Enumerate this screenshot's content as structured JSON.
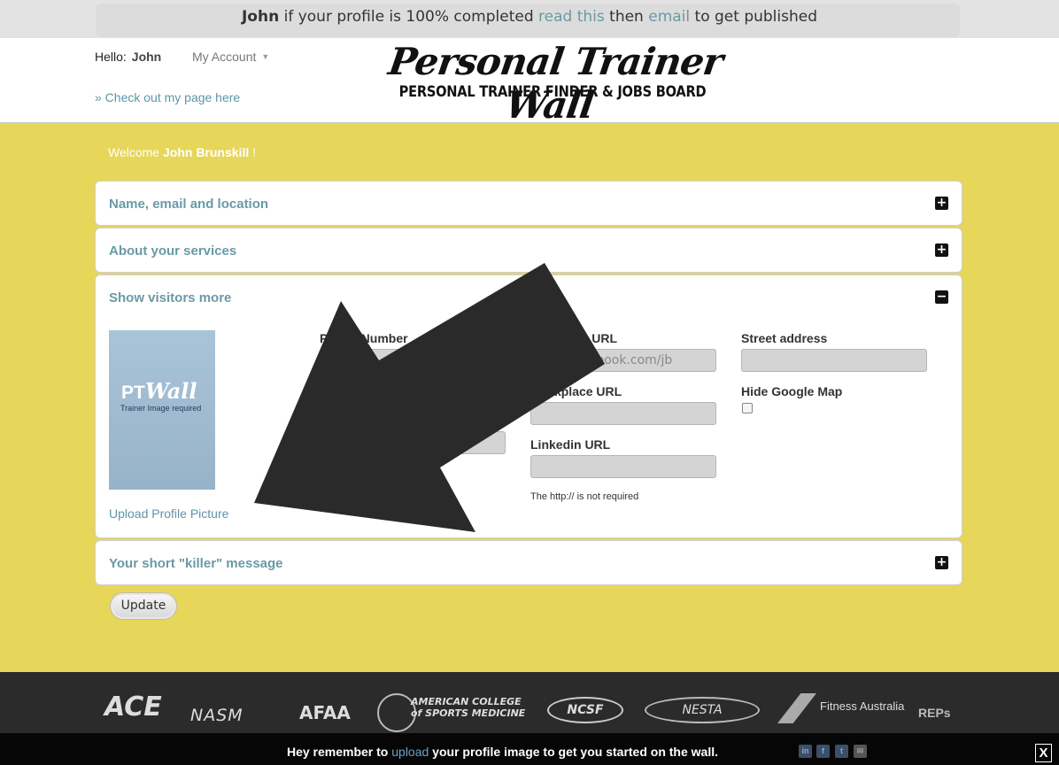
{
  "topbar": {
    "name": "John",
    "text1": " if your profile is 100% completed ",
    "link1": "read this",
    "text2": " then ",
    "link2": "email",
    "text3": " to get published"
  },
  "header": {
    "hello_label": "Hello:",
    "hello_name": "John",
    "my_account": "My Account",
    "check_page": "» Check out my page here",
    "logo_title": "Personal Trainer Wall",
    "logo_subtitle": "PERSONAL TRAINER FINDER & JOBS BOARD"
  },
  "main": {
    "welcome_prefix": "Welcome ",
    "welcome_name": "John Brunskill",
    "welcome_suffix": " !",
    "panels": [
      {
        "title": "Name, email and location",
        "toggle": "+"
      },
      {
        "title": "About your services",
        "toggle": "+"
      },
      {
        "title": "Show visitors more",
        "toggle": "−"
      },
      {
        "title": "Your short \"killer\" message",
        "toggle": "+"
      }
    ],
    "thumbnail": {
      "brand_pt": "PT",
      "brand_wall": "Wall",
      "caption": "Trainer Image required"
    },
    "upload_link": "Upload Profile Picture",
    "fields": {
      "phone_label": "Phone Number",
      "facebook_label": "Facebook URL",
      "facebook_value": "www.facebook.com/jb",
      "workplace_label": "Workplace URL",
      "linkedin_label": "Linkedin URL",
      "street_label": "Street address",
      "hide_map_label": "Hide Google Map",
      "hide_map_checked": false,
      "url_note": "The http:// is not required"
    },
    "update_button": "Update"
  },
  "footer": {
    "logos": [
      "ACE",
      "NASM",
      "AFAA",
      "AMERICAN COLLEGE of SPORTS MEDICINE",
      "NCSF",
      "NESTA",
      "Fitness Australia",
      "REPs"
    ]
  },
  "bottom_bar": {
    "text1": "Hey remember to ",
    "link": "upload",
    "text2": " your profile image to get you started on the wall.",
    "close": "X"
  },
  "colors": {
    "background_yellow": "#e6d65a",
    "link_teal": "#6b99a6",
    "footer_dark": "#2b2b2b"
  }
}
